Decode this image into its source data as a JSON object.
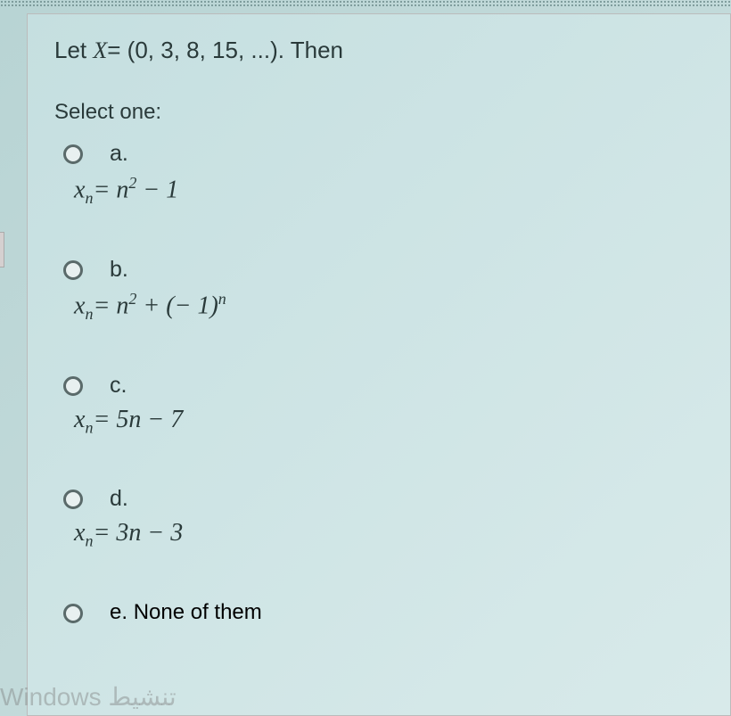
{
  "question": {
    "prefix": "Let ",
    "var": "X",
    "equals": "= (0, 3, 8, 15, ...). Then"
  },
  "select_label": "Select one:",
  "options": {
    "a": {
      "letter": "a.",
      "xvar": "x",
      "sub": "n",
      "eq1": "= n",
      "sup1": "2",
      "rest1": " − 1"
    },
    "b": {
      "letter": "b.",
      "xvar": "x",
      "sub": "n",
      "eq1": "= n",
      "sup1": "2",
      "mid": " + (− 1)",
      "sup2": "n"
    },
    "c": {
      "letter": "c.",
      "xvar": "x",
      "sub": "n",
      "eq1": "= 5n − 7"
    },
    "d": {
      "letter": "d.",
      "xvar": "x",
      "sub": "n",
      "eq1": "= 3n − 3"
    },
    "e": {
      "letter": "e.",
      "text": "None of them"
    }
  },
  "watermark": "Windows تنشيط"
}
